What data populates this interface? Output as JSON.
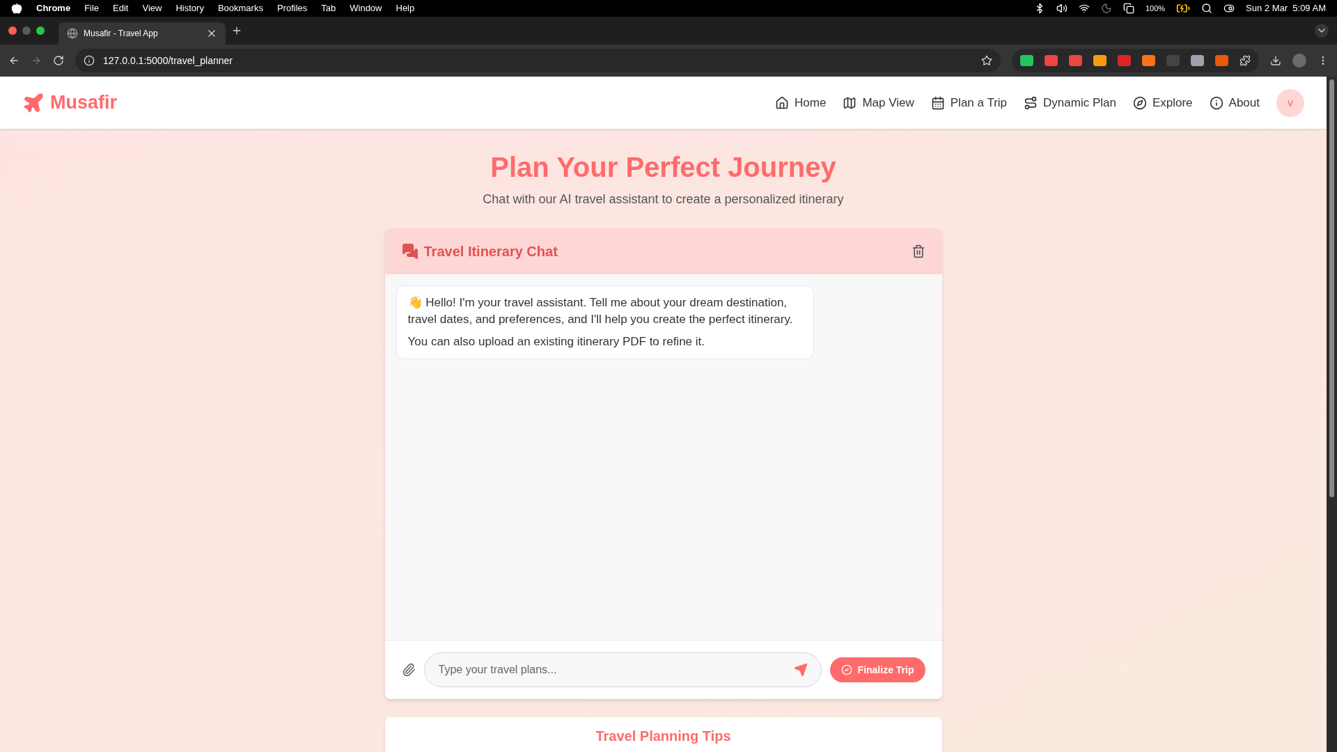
{
  "menu_bar": {
    "items": [
      {
        "label": "Chrome",
        "kind": "app"
      },
      {
        "label": "File",
        "kind": "menu"
      },
      {
        "label": "Edit",
        "kind": "menu"
      },
      {
        "label": "View",
        "kind": "menu"
      },
      {
        "label": "History",
        "kind": "menu"
      },
      {
        "label": "Bookmarks",
        "kind": "menu"
      },
      {
        "label": "Profiles",
        "kind": "menu"
      },
      {
        "label": "Tab",
        "kind": "menu"
      },
      {
        "label": "Window",
        "kind": "menu"
      },
      {
        "label": "Help",
        "kind": "menu"
      }
    ],
    "battery": "100%",
    "clock": "Sun 2 Mar  5:09 AM"
  },
  "browser": {
    "tabs": [
      {
        "title": "Musafir - Travel App",
        "selected": true
      }
    ],
    "url": "127.0.0.1:5000/travel_planner"
  },
  "navbar": {
    "brand": "Musafir",
    "links": [
      {
        "label": "Home"
      },
      {
        "label": "Map View"
      },
      {
        "label": "Plan a Trip"
      },
      {
        "label": "Dynamic Plan"
      },
      {
        "label": "Explore"
      },
      {
        "label": "About"
      }
    ],
    "avatar": "v"
  },
  "hero": {
    "title": "Plan Your Perfect Journey",
    "subtitle": "Chat with our AI travel assistant to create a personalized itinerary"
  },
  "chat": {
    "title": "Travel Itinerary Chat",
    "messages": [
      {
        "kind": "assistant",
        "paragraphs": [
          "👋 Hello! I'm your travel assistant. Tell me about your dream destination, travel dates, and preferences, and I'll help you create the perfect itinerary.",
          "You can also upload an existing itinerary PDF to refine it."
        ]
      }
    ],
    "input": {
      "placeholder": "Type your travel plans..."
    },
    "finalize_button": "Finalize Trip"
  },
  "tips": {
    "title": "Travel Planning Tips"
  }
}
